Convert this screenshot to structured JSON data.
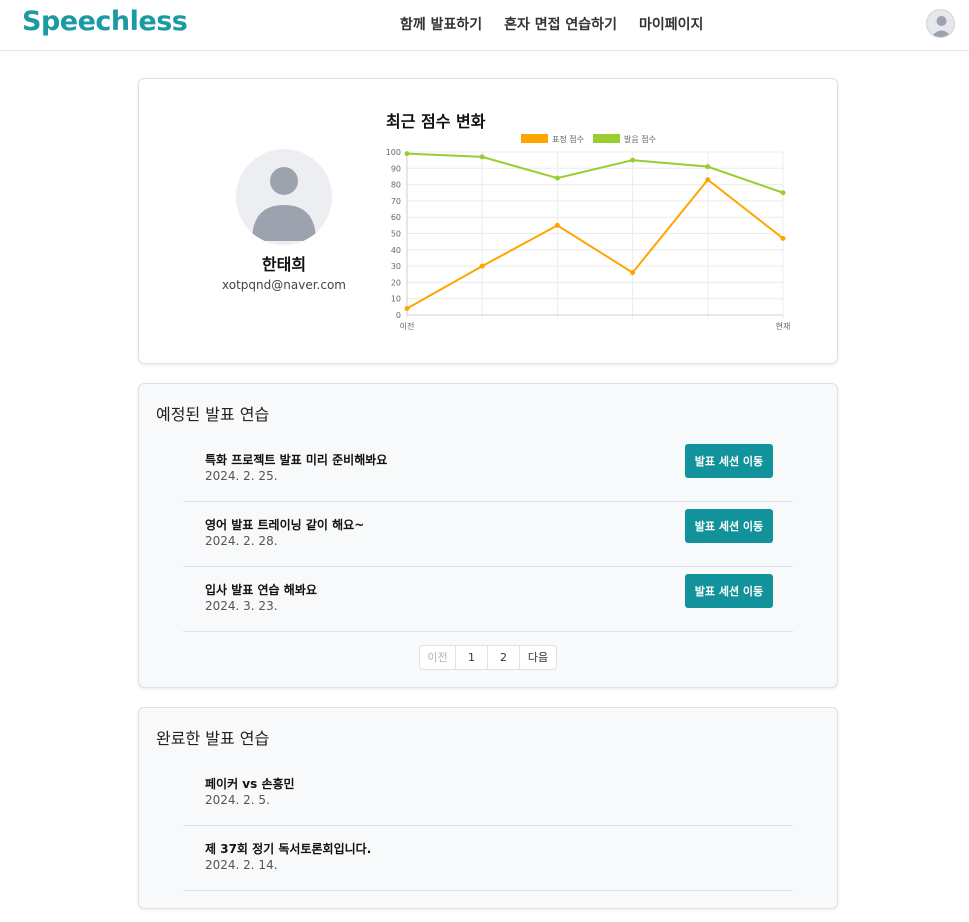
{
  "header": {
    "logo": "Speechless",
    "nav": [
      "함께 발표하기",
      "혼자 면접 연습하기",
      "마이페이지"
    ]
  },
  "profile": {
    "name": "한태희",
    "email": "xotpqnd@naver.com"
  },
  "chart_data": {
    "type": "line",
    "title": "최근 점수 변화",
    "x": [
      "이전",
      "",
      "",
      "",
      "",
      "현재"
    ],
    "series": [
      {
        "name": "표정 점수",
        "color": "#ffa500",
        "values": [
          4,
          30,
          55,
          26,
          83,
          47
        ]
      },
      {
        "name": "발음 점수",
        "color": "#9acd32",
        "values": [
          99,
          97,
          84,
          95,
          91,
          75
        ]
      }
    ],
    "ylim": [
      0,
      100
    ],
    "yticks": [
      0,
      10,
      20,
      30,
      40,
      50,
      60,
      70,
      80,
      90,
      100
    ],
    "grid": true,
    "legend": "top"
  },
  "upcoming": {
    "title": "예정된 발표 연습",
    "sessions": [
      {
        "title": "특화 프로젝트 발표 미리 준비해봐요",
        "date": "2024. 2. 25.",
        "button": "발표 세션 이동"
      },
      {
        "title": "영어 발표 트레이닝 같이 해요~",
        "date": "2024. 2. 28.",
        "button": "발표 세션 이동"
      },
      {
        "title": "입사 발표 연습 해봐요",
        "date": "2024. 3. 23.",
        "button": "발표 세션 이동"
      }
    ],
    "pagination": {
      "prev": "이전",
      "pages": [
        "1",
        "2"
      ],
      "next": "다음"
    }
  },
  "completed": {
    "title": "완료한 발표 연습",
    "sessions": [
      {
        "title": "페이커 vs 손흥민",
        "date": "2024. 2. 5."
      },
      {
        "title": "제 37회 정기 독서토론회입니다.",
        "date": "2024. 2. 14."
      }
    ]
  }
}
